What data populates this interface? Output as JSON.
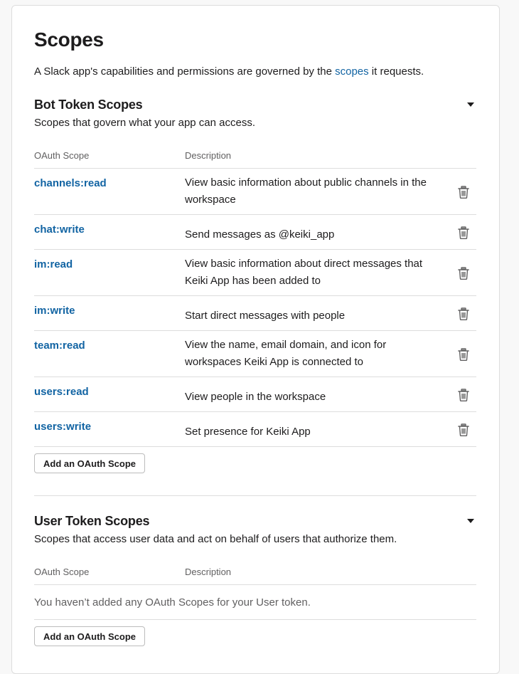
{
  "page": {
    "title": "Scopes",
    "intro_prefix": "A Slack app's capabilities and permissions are governed by the ",
    "intro_link": "scopes",
    "intro_suffix": " it requests."
  },
  "bot_section": {
    "title": "Bot Token Scopes",
    "subtitle": "Scopes that govern what your app can access.",
    "col_scope": "OAuth Scope",
    "col_description": "Description",
    "rows": [
      {
        "scope": "channels:read",
        "description": "View basic information about public channels in the workspace"
      },
      {
        "scope": "chat:write",
        "description": "Send messages as @keiki_app"
      },
      {
        "scope": "im:read",
        "description": "View basic information about direct messages that Keiki App has been added to"
      },
      {
        "scope": "im:write",
        "description": "Start direct messages with people"
      },
      {
        "scope": "team:read",
        "description": "View the name, email domain, and icon for workspaces Keiki App is connected to"
      },
      {
        "scope": "users:read",
        "description": "View people in the workspace"
      },
      {
        "scope": "users:write",
        "description": "Set presence for Keiki App"
      }
    ],
    "add_button": "Add an OAuth Scope"
  },
  "user_section": {
    "title": "User Token Scopes",
    "subtitle": "Scopes that access user data and act on behalf of users that authorize them.",
    "col_scope": "OAuth Scope",
    "col_description": "Description",
    "empty_message": "You haven’t added any OAuth Scopes for your User token.",
    "add_button": "Add an OAuth Scope"
  },
  "colors": {
    "link": "#1264a3",
    "text": "#1d1c1d",
    "muted": "#616061",
    "divider": "#dddddd"
  },
  "icons": {
    "collapse": "caret-down-icon",
    "remove": "trash-icon"
  }
}
